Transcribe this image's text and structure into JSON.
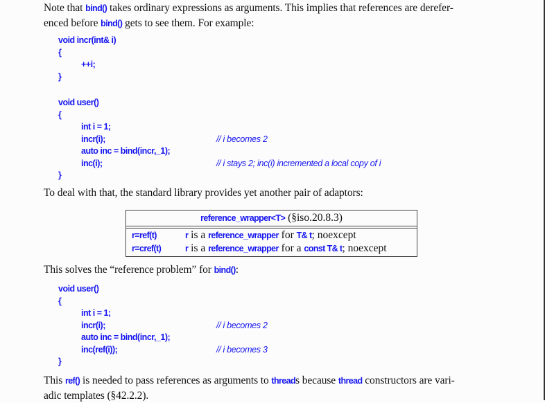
{
  "paragraph1": {
    "t1": "Note that ",
    "c1": "bind()",
    "t2": " takes ordinary expressions as arguments.  This implies that references are derefer-",
    "t3": "enced before ",
    "c2": "bind()",
    "t4": " gets to see them.  For example:"
  },
  "code1": [
    {
      "code": "void incr(int& i)",
      "indent": false,
      "comment": ""
    },
    {
      "code": "{",
      "indent": false,
      "comment": ""
    },
    {
      "code": "++i;",
      "indent": true,
      "comment": ""
    },
    {
      "code": "}",
      "indent": false,
      "comment": ""
    }
  ],
  "code2": [
    {
      "code": "void user()",
      "indent": false,
      "comment": ""
    },
    {
      "code": "{",
      "indent": false,
      "comment": ""
    },
    {
      "code": "int i = 1;",
      "indent": true,
      "comment": ""
    },
    {
      "code": "incr(i);",
      "indent": true,
      "comment": "// i becomes 2"
    },
    {
      "code": "auto inc = bind(incr,_1);",
      "indent": true,
      "comment": ""
    },
    {
      "code": "inc(i);",
      "indent": true,
      "comment": "// i stays 2; inc(i) incremented a local copy of i"
    },
    {
      "code": "}",
      "indent": false,
      "comment": ""
    }
  ],
  "paragraph2": "To deal with that, the standard library provides yet another pair of adaptors:",
  "table": {
    "header_code": "reference_wrapper<T>",
    "header_text": " (§iso.20.8.3)",
    "rows": [
      {
        "key": "r=ref(t)",
        "v": [
          [
            "c",
            "r"
          ],
          [
            "t",
            " is a "
          ],
          [
            "c",
            "reference_wrapper"
          ],
          [
            "t",
            " for "
          ],
          [
            "c",
            "T& t"
          ],
          [
            "t",
            "; noexcept"
          ]
        ]
      },
      {
        "key": "r=cref(t)",
        "v": [
          [
            "c",
            "r"
          ],
          [
            "t",
            " is a "
          ],
          [
            "c",
            "reference_wrapper"
          ],
          [
            "t",
            " for a "
          ],
          [
            "c",
            "const T& t"
          ],
          [
            "t",
            "; noexcept"
          ]
        ]
      }
    ]
  },
  "paragraph3": {
    "t1": "This solves the “reference problem” for ",
    "c1": "bind()",
    "t2": ":"
  },
  "code3": [
    {
      "code": "void user()",
      "indent": false,
      "comment": ""
    },
    {
      "code": "{",
      "indent": false,
      "comment": ""
    },
    {
      "code": "int i = 1;",
      "indent": true,
      "comment": ""
    },
    {
      "code": "incr(i);",
      "indent": true,
      "comment": "// i becomes 2"
    },
    {
      "code": "auto inc = bind(incr,_1);",
      "indent": true,
      "comment": ""
    },
    {
      "code": "inc(ref(i));",
      "indent": true,
      "comment": "// i becomes 3"
    },
    {
      "code": "}",
      "indent": false,
      "comment": ""
    }
  ],
  "paragraph4": {
    "t1": "This ",
    "c1": "ref()",
    "t2": " is needed to pass references as arguments to ",
    "c2": "thread",
    "t3": "s because ",
    "c3": "thread",
    "t4": " constructors are vari-",
    "t5": "adic templates (§42.2.2)."
  }
}
